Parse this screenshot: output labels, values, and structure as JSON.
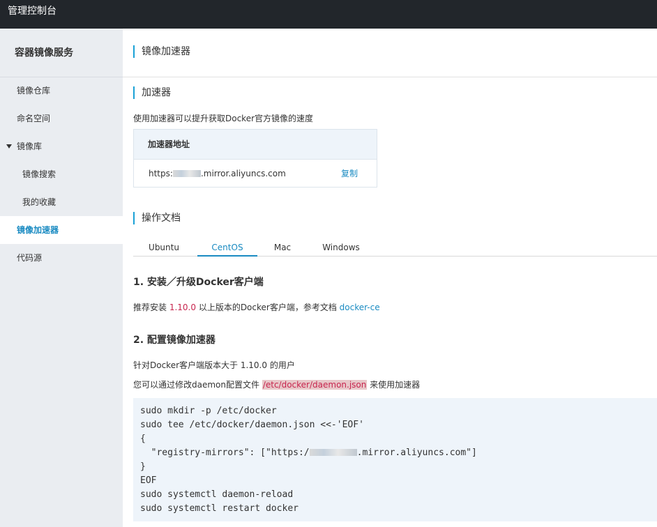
{
  "topbar": {
    "title": "管理控制台"
  },
  "sidebar": {
    "service_title": "容器镜像服务",
    "items": [
      {
        "label": "镜像仓库"
      },
      {
        "label": "命名空间"
      },
      {
        "label": "镜像库"
      },
      {
        "label": "镜像搜索"
      },
      {
        "label": "我的收藏"
      },
      {
        "label": "镜像加速器"
      },
      {
        "label": "代码源"
      }
    ]
  },
  "page": {
    "title": "镜像加速器",
    "accelerator": {
      "section_title": "加速器",
      "description": "使用加速器可以提升获取Docker官方镜像的速度",
      "table_header": "加速器地址",
      "url_prefix": "https:",
      "url_suffix": ".mirror.aliyuncs.com",
      "copy_label": "复制"
    },
    "docs": {
      "section_title": "操作文档",
      "tabs": [
        "Ubuntu",
        "CentOS",
        "Mac",
        "Windows"
      ],
      "active_tab": "CentOS",
      "step1": {
        "title": "1. 安装／升级Docker客户端",
        "text_before": "推荐安装 ",
        "version": "1.10.0",
        "text_middle": " 以上版本的Docker客户端，参考文档 ",
        "link": "docker-ce"
      },
      "step2": {
        "title": "2. 配置镜像加速器",
        "line1": "针对Docker客户端版本大于 1.10.0 的用户",
        "line2_before": "您可以通过修改daemon配置文件 ",
        "path": "/etc/docker/daemon.json",
        "line2_after": " 来使用加速器"
      },
      "code": {
        "line1": "sudo mkdir -p /etc/docker",
        "line2": "sudo tee /etc/docker/daemon.json <<-'EOF'",
        "line3": "{",
        "line4_before": "  \"registry-mirrors\": [\"https:/",
        "line4_after": ".mirror.aliyuncs.com\"]",
        "line5": "}",
        "line6": "EOF",
        "line7": "sudo systemctl daemon-reload",
        "line8": "sudo systemctl restart docker"
      }
    }
  },
  "colors": {
    "topbar_bg": "#22262b",
    "sidebar_bg": "#eaedf1",
    "accent": "#1a8bc2",
    "section_bar": "#1aa1d6",
    "version_red": "#c7254e",
    "path_highlight": "#e8c7c9",
    "code_bg": "#eef4fa"
  }
}
